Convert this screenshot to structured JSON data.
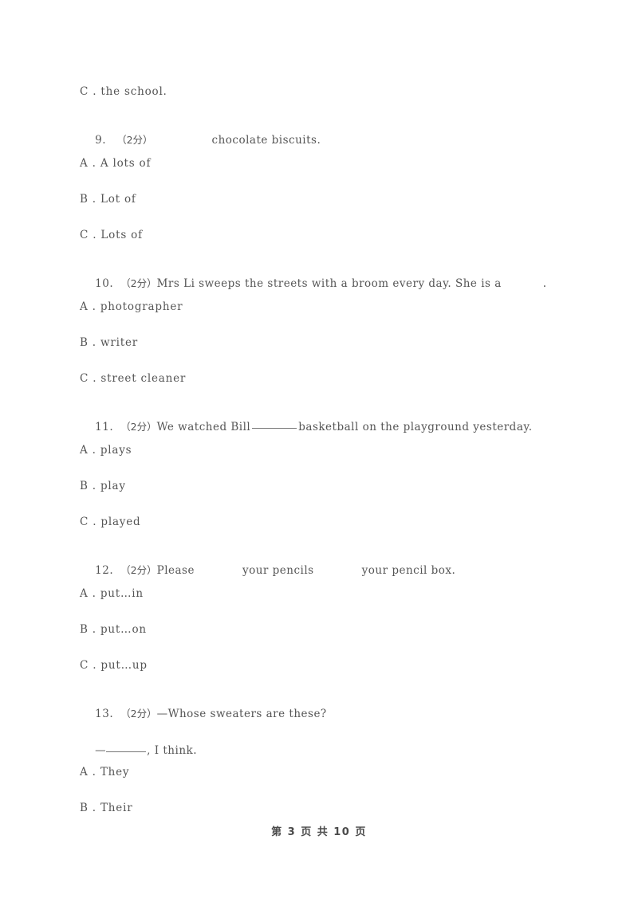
{
  "document": {
    "footer": "第 3 页 共 10 页",
    "page_number": "3",
    "total_pages": "10"
  },
  "content": {
    "carryover_option": "C . the school.",
    "questions": [
      {
        "number": "9.",
        "marks": "（2分）",
        "stem_before": "",
        "stem_after": "chocolate biscuits.",
        "options": [
          "A . A lots of",
          "B . Lot of",
          "C . Lots of"
        ]
      },
      {
        "number": "10.",
        "marks": "（2分）",
        "stem_before": "Mrs Li sweeps the streets with a broom every day. She is a",
        "stem_after": ".",
        "options": [
          "A . photographer",
          "B . writer",
          "C . street cleaner"
        ]
      },
      {
        "number": "11.",
        "marks": "（2分）",
        "stem_before": "We watched Bill",
        "stem_after": "basketball on the playground yesterday.",
        "options": [
          "A . plays",
          "B . play",
          "C . played"
        ]
      },
      {
        "number": "12.",
        "marks": "（2分）",
        "stem_before": "Please",
        "stem_middle": "your pencils",
        "stem_after": "your pencil box.",
        "options": [
          "A . put…in",
          "B . put…on",
          "C . put…up"
        ]
      },
      {
        "number": "13.",
        "marks": "（2分）",
        "stem_before": "—Whose sweaters are these?",
        "answer_line_prefix": "—",
        "answer_line_suffix": ", I think.",
        "options": [
          "A . They",
          "B . Their"
        ]
      }
    ]
  }
}
